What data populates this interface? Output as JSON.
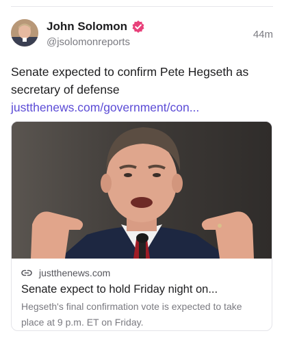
{
  "post": {
    "author_name": "John Solomon",
    "handle": "@jsolomonreports",
    "timestamp": "44m",
    "text": "Senate expected to confirm Pete Hegseth as secretary of defense ",
    "link_text": "justthenews.com/government/con..."
  },
  "link_card": {
    "domain": "justthenews.com",
    "title": "Senate expect to hold Friday night on...",
    "description": "Hegseth's final confirmation vote is expected to take place at 9 p.m. ET on Friday."
  },
  "icons": {
    "verified": "verified-badge-icon",
    "link": "link-icon"
  },
  "colors": {
    "link": "#5b4bd6",
    "verified_badge": "#e8417a",
    "secondary_text": "#7a7a80"
  }
}
